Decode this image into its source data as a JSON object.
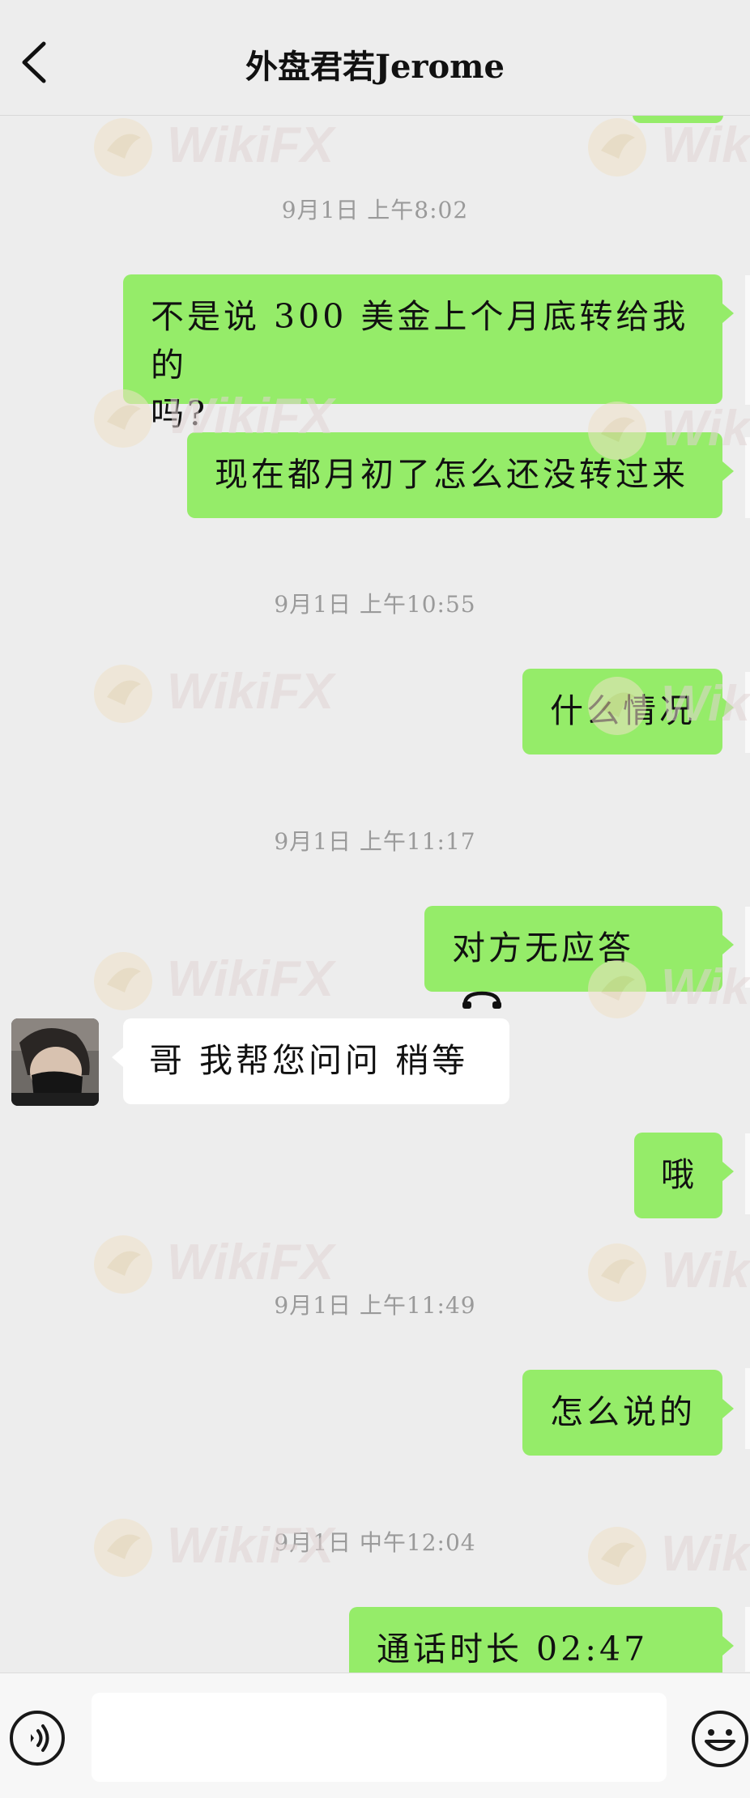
{
  "header": {
    "title": "外盘君若Jerome"
  },
  "watermark": {
    "text": "WikiFX"
  },
  "messages": [
    {
      "type": "time",
      "text": "9月1日  上午8:02"
    },
    {
      "type": "out",
      "line1": "不是说 300 美金上个月底转给我的",
      "line2": "吗?"
    },
    {
      "type": "out",
      "text": "现在都月初了怎么还没转过来"
    },
    {
      "type": "time",
      "text": "9月1日  上午10:55"
    },
    {
      "type": "out",
      "text": "什么情况"
    },
    {
      "type": "time",
      "text": "9月1日  上午11:17"
    },
    {
      "type": "out",
      "text": "对方无应答"
    },
    {
      "type": "in",
      "text": "哥  我帮您问问  稍等"
    },
    {
      "type": "out",
      "text": "哦"
    },
    {
      "type": "time",
      "text": "9月1日  上午11:49"
    },
    {
      "type": "out",
      "text": "怎么说的"
    },
    {
      "type": "time",
      "text": "9月1日  中午12:04"
    },
    {
      "type": "out",
      "text": "通话时长  02:47"
    }
  ],
  "colors": {
    "outgoing_bubble": "#95ec69",
    "incoming_bubble": "#ffffff",
    "background": "#ededed"
  },
  "icons": {
    "back": "chevron-left-icon",
    "call": "phone-hangup-icon",
    "voice": "voice-icon",
    "emoji": "emoji-icon"
  }
}
